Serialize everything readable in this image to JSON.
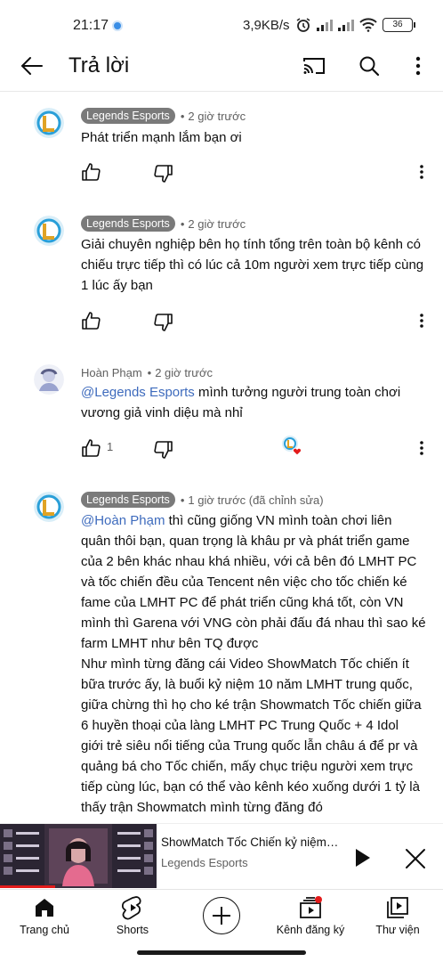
{
  "status_bar": {
    "time": "21:17",
    "network_speed": "3,9KB/s",
    "battery": "36"
  },
  "header": {
    "title": "Trả lời",
    "icons": [
      "back-arrow-icon",
      "cast-icon",
      "search-icon",
      "more-vertical-icon"
    ]
  },
  "comments": [
    {
      "author": "Legends Esports",
      "author_style": "channel-chip",
      "time": "2 giờ trước",
      "avatar": "legends-esports-logo",
      "text": "Phát triển mạnh lắm bạn ơi",
      "likes": ""
    },
    {
      "author": "Legends Esports",
      "author_style": "channel-chip",
      "time": "2 giờ trước",
      "avatar": "legends-esports-logo",
      "text": "Giải chuyên nghiệp bên họ tính tổng trên toàn bộ kênh có\nchiếu trực tiếp thì có lúc cả 10m người xem trực tiếp cùng\n1 lúc ấy bạn",
      "likes": ""
    },
    {
      "author": "Hoàn Phạm",
      "author_style": "plain",
      "time": "2 giờ trước",
      "avatar": "user-avatar",
      "mention": "@Legends Esports",
      "text": " mình tưởng người trung toàn chơi\nvương giả vinh diệu mà nhỉ",
      "likes": "1",
      "creator_heart": true
    },
    {
      "author": "Legends Esports",
      "author_style": "channel-chip",
      "time": "1 giờ trước (đã chỉnh sửa)",
      "avatar": "legends-esports-logo",
      "mention": "@Hoàn Phạm",
      "text": " thì cũng giống VN mình toàn chơi liên\nquân thôi bạn, quan trọng là khâu pr và phát triển game\ncủa 2 bên khác nhau khá nhiều, với cả bên đó LMHT PC\nvà tốc chiến đều của Tencent nên việc cho tốc chiến ké\nfame của LMHT PC để phát triển cũng khá tốt, còn VN\nmình thì Garena với VNG còn phải đấu đá nhau thì sao ké\nfarm LMHT như bên TQ được\nNhư mình từng đăng cái Video ShowMatch Tốc chiến ít\nbữa trước ấy, là buổi kỷ niệm 10 năm LMHT trung quốc,\ngiữa chừng thì họ cho ké trận Showmatch Tốc chiến giữa\n6 huyền thoại của làng LMHT PC Trung Quốc + 4 Idol\ngiới trẻ siêu nổi tiếng của Trung quốc lẫn châu á để pr và\nquảng bá cho Tốc chiến, mấy chục triệu người xem trực\ntiếp cùng lúc, bạn có thể vào kênh kéo xuống dưới 1 tỷ là\nthấy trận Showmatch mình từng đăng đó",
      "likes": ""
    }
  ],
  "mini_player": {
    "title": "ShowMatch Tốc Chiến kỷ niệm 1..",
    "channel": "Legends Esports",
    "progress": 0.35
  },
  "bottom_nav": {
    "home": "Trang chủ",
    "shorts": "Shorts",
    "create": "",
    "subscriptions": "Kênh đăng ký",
    "library": "Thư viện"
  },
  "colors": {
    "mention": "#3e6bbd",
    "chip_bg": "#7a7a7a",
    "progress": "#e31b1b",
    "heart": "#e31b1b"
  }
}
